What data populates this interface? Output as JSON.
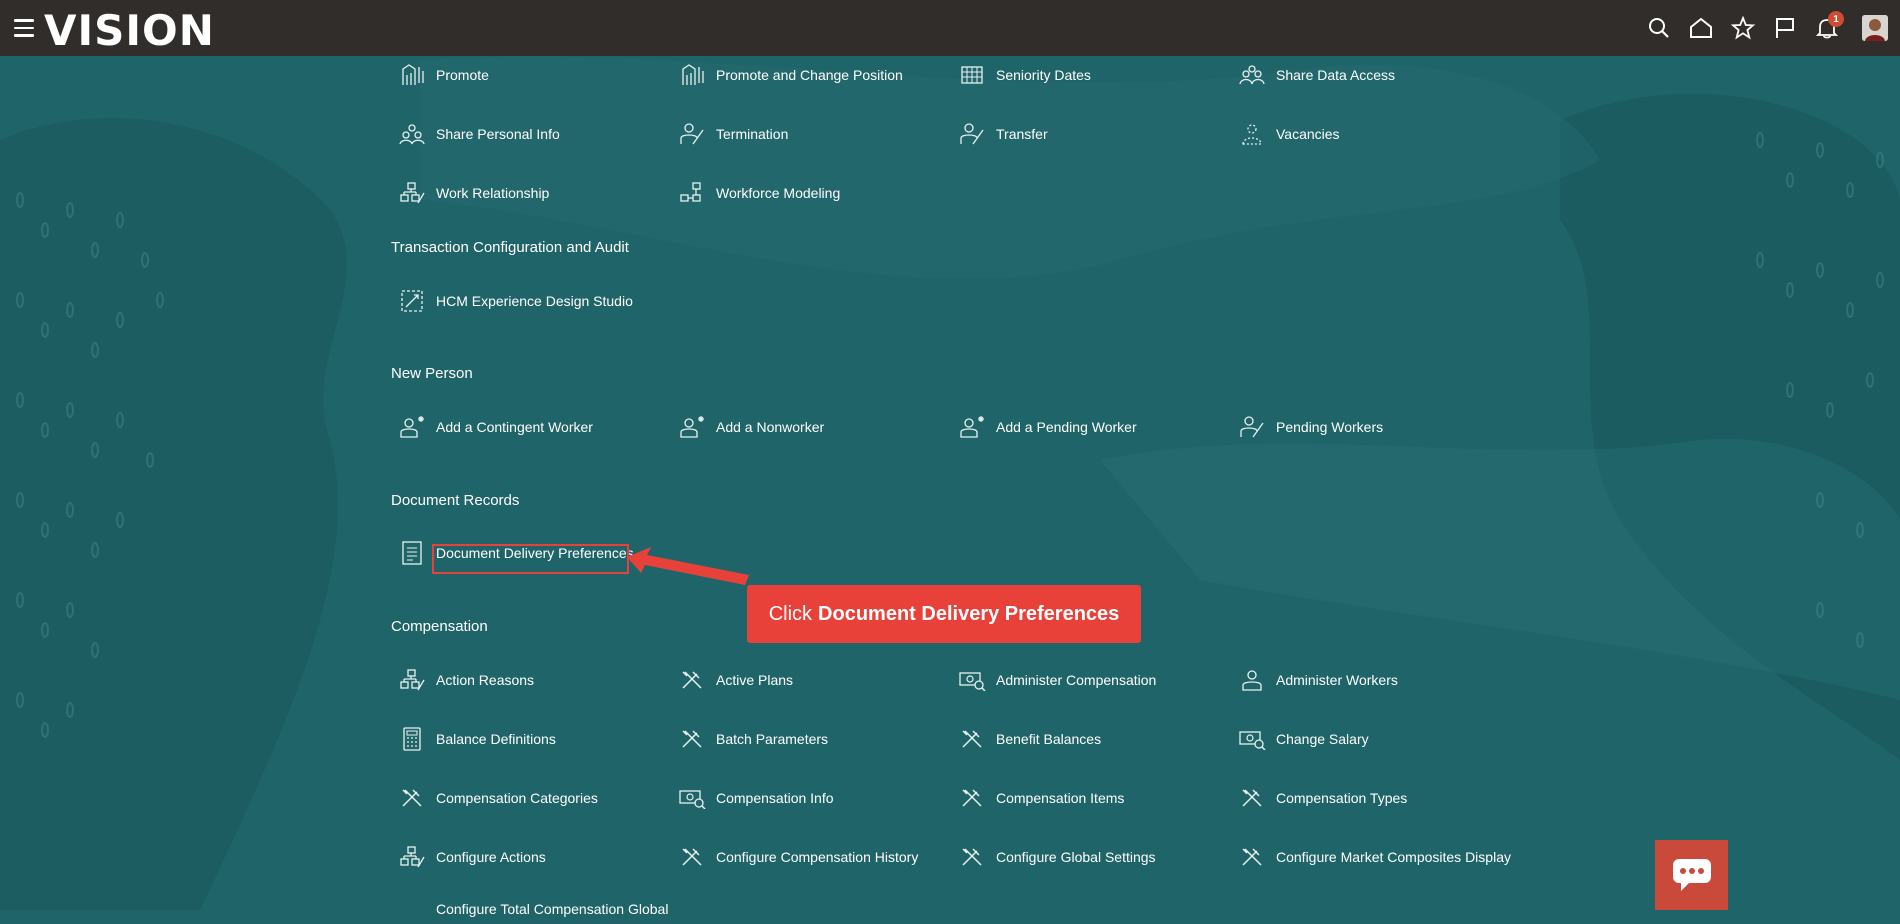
{
  "header": {
    "logo": "VISION",
    "notification_count": "1"
  },
  "sections": {
    "top": {
      "items": [
        "Promote",
        "Promote and Change Position",
        "Seniority Dates",
        "Share Data Access",
        "Share Personal Info",
        "Termination",
        "Transfer",
        "Vacancies",
        "Work Relationship",
        "Workforce Modeling"
      ]
    },
    "transaction": {
      "title": "Transaction Configuration and Audit",
      "items": [
        "HCM Experience Design Studio"
      ]
    },
    "new_person": {
      "title": "New Person",
      "items": [
        "Add a Contingent Worker",
        "Add a Nonworker",
        "Add a Pending Worker",
        "Pending Workers"
      ]
    },
    "document_records": {
      "title": "Document Records",
      "items": [
        "Document Delivery Preferences"
      ]
    },
    "compensation": {
      "title": "Compensation",
      "items": [
        "Action Reasons",
        "Active Plans",
        "Administer Compensation",
        "Administer Workers",
        "Balance Definitions",
        "Batch Parameters",
        "Benefit Balances",
        "Change Salary",
        "Compensation Categories",
        "Compensation Info",
        "Compensation Items",
        "Compensation Types",
        "Configure Actions",
        "Configure Compensation History",
        "Configure Global Settings",
        "Configure Market Composites Display",
        "Configure Total Compensation Global"
      ]
    }
  },
  "callout": {
    "prefix": "Click",
    "target": "Document Delivery Preferences"
  },
  "colors": {
    "topbar": "#312d2a",
    "background": "#1f6468",
    "callout": "#e8413a",
    "chat": "#c94a3a"
  }
}
